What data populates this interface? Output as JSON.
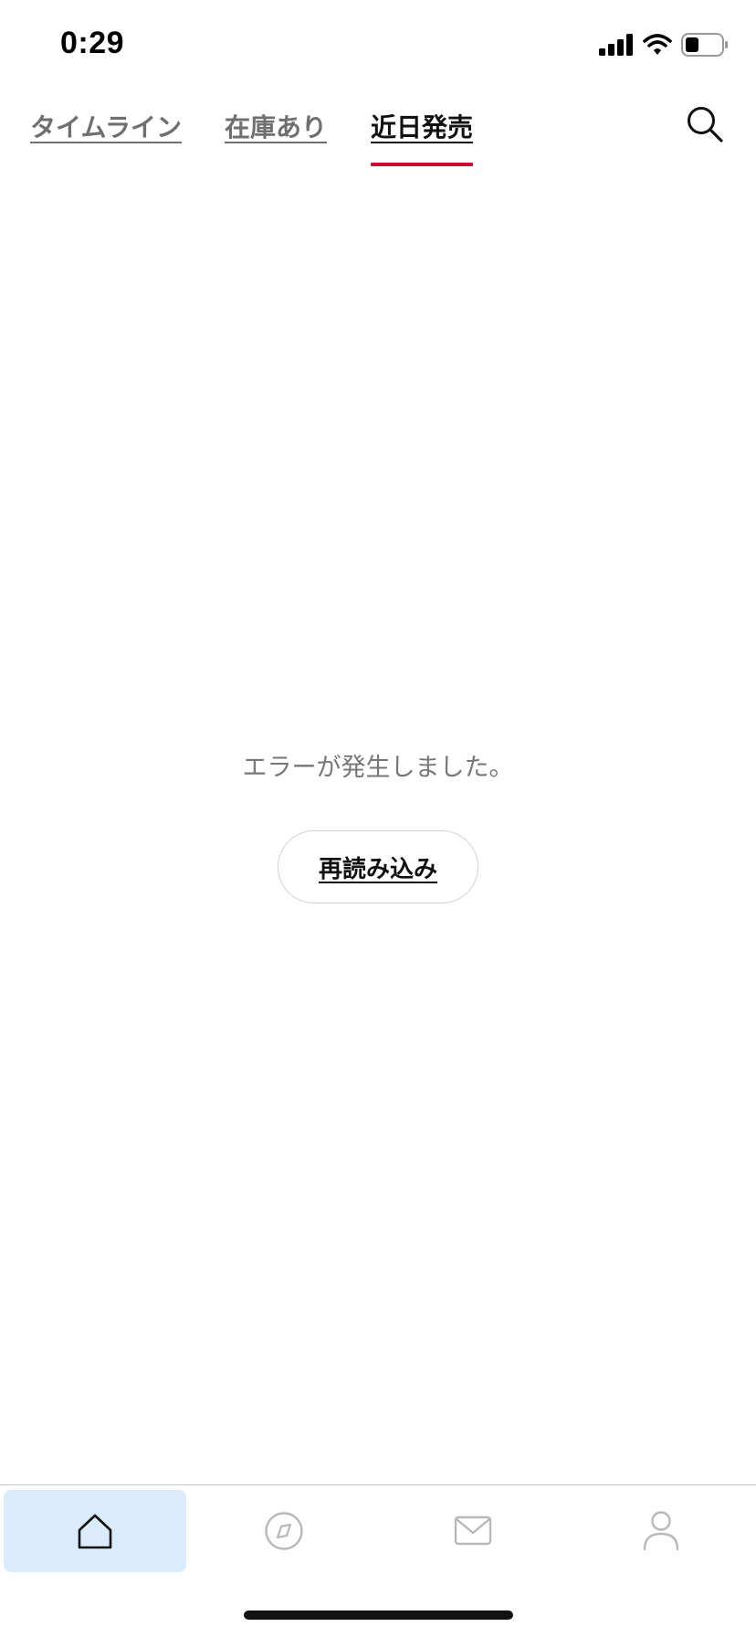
{
  "status_bar": {
    "time": "0:29",
    "icons": [
      "signal-icon",
      "wifi-icon",
      "battery-icon"
    ]
  },
  "tabs": [
    {
      "label": "タイムライン",
      "active": false
    },
    {
      "label": "在庫あり",
      "active": false
    },
    {
      "label": "近日発売",
      "active": true
    }
  ],
  "search": {
    "icon": "search-icon"
  },
  "error": {
    "message": "エラーが発生しました。",
    "reload_label": "再読み込み"
  },
  "bottom_nav": {
    "items": [
      {
        "icon": "home-icon",
        "active": true
      },
      {
        "icon": "compass-icon",
        "active": false
      },
      {
        "icon": "mail-icon",
        "active": false
      },
      {
        "icon": "profile-icon",
        "active": false
      }
    ]
  },
  "colors": {
    "accent": "#c8102e",
    "active_nav_bg": "#d9ebfd",
    "inactive_tab_text": "#6f6f6f",
    "active_tab_text": "#111111",
    "muted_text": "#777777",
    "nav_icon_inactive": "#b8b8b8"
  }
}
